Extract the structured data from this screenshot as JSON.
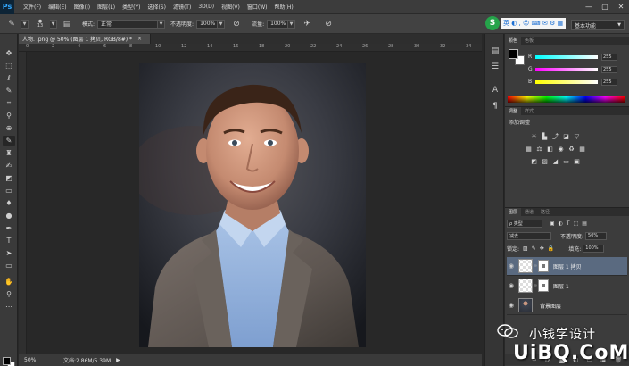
{
  "app": {
    "logo": "Ps"
  },
  "menu": [
    "文件(F)",
    "编辑(E)",
    "图像(I)",
    "图层(L)",
    "类型(Y)",
    "选择(S)",
    "滤镜(T)",
    "3D(D)",
    "视图(V)",
    "窗口(W)",
    "帮助(H)"
  ],
  "window_controls": [
    "—",
    "▢",
    "✕"
  ],
  "options": {
    "brush_size": "13",
    "mode_label": "模式:",
    "mode_value": "正常",
    "opacity_label": "不透明度:",
    "opacity_value": "100%",
    "flow_label": "流量:",
    "flow_value": "100%"
  },
  "ime": {
    "logo": "S",
    "text": "英 ◐ , ☺ ⌨ ✉ ⚙ ▦"
  },
  "workspace": {
    "value": "基本功能"
  },
  "document": {
    "tab_title": "人物. .png @ 50% (图层 1 拷贝, RGB/8#) *",
    "tab_close": "×",
    "ruler_ticks": [
      "0",
      "2",
      "4",
      "6",
      "8",
      "10",
      "12",
      "14",
      "16",
      "18",
      "20",
      "22",
      "24",
      "26",
      "28",
      "30",
      "32",
      "34"
    ],
    "zoom": "50%",
    "doc_info": "文档:2.86M/5.39M",
    "status_arrow": "▶"
  },
  "color_panel": {
    "tabs": [
      "颜色",
      "色板"
    ],
    "sliders": [
      {
        "label": "R",
        "value": "255"
      },
      {
        "label": "G",
        "value": "255"
      },
      {
        "label": "B",
        "value": "255"
      }
    ]
  },
  "adjustments_panel": {
    "tabs": [
      "调整",
      "样式"
    ],
    "title": "添加调整"
  },
  "layers_panel": {
    "tabs": [
      "图层",
      "通道",
      "路径"
    ],
    "filter_label": "ρ 类型",
    "blend_mode": "减去",
    "opacity_label": "不透明度:",
    "opacity_value": "50%",
    "lock_label": "锁定:",
    "fill_label": "填充:",
    "fill_value": "100%",
    "layers": [
      {
        "name": "图层 1 拷贝",
        "selected": true
      },
      {
        "name": "图层 1",
        "selected": false
      },
      {
        "name": "背景图层",
        "selected": false
      }
    ]
  },
  "watermark": {
    "text1": "小钱学设计",
    "text2": "UiBQ.CoM"
  }
}
